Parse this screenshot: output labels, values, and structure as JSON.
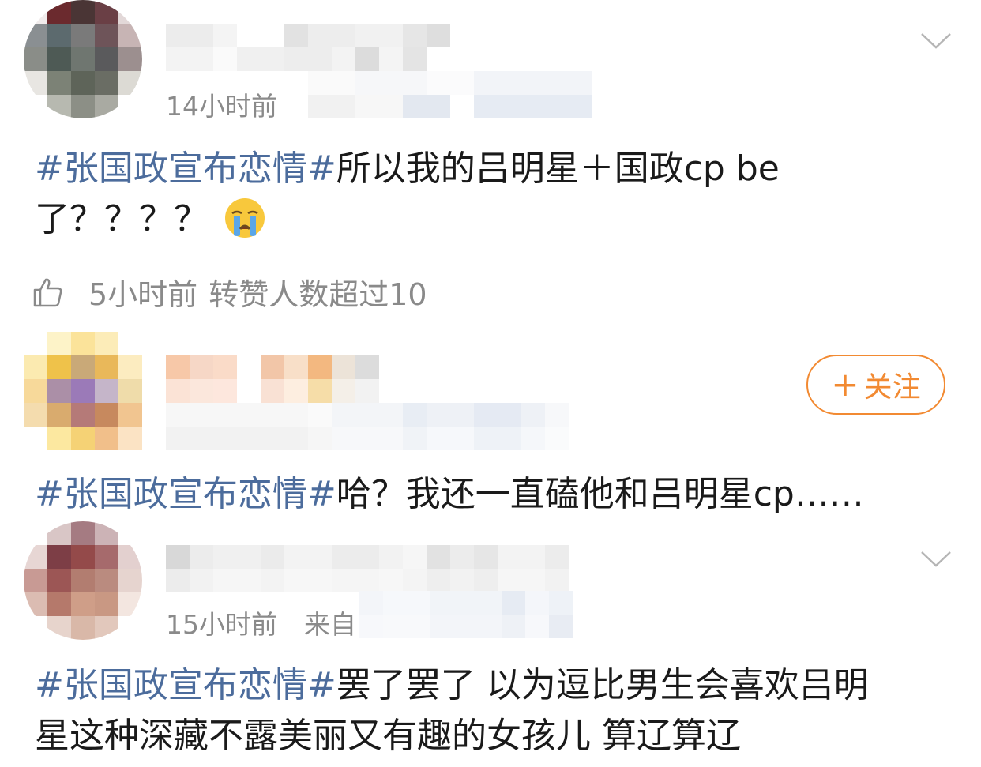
{
  "posts": [
    {
      "time": "14小时前",
      "source_visible": "",
      "text_tag": "#张国政宣布恋情#",
      "text_body": "所以我的吕明星＋国政cp  be",
      "text_body_line2": "了？？？？",
      "emoji_icon": "crying-face-icon",
      "likes_time": "5小时前",
      "likes_text": "转赞人数超过10",
      "has_chevron": true
    },
    {
      "time": "",
      "follow_label": "关注",
      "text_tag": "#张国政宣布恋情#",
      "text_body": "哈？我还一直磕他和吕明星cp……"
    },
    {
      "time": "15小时前",
      "source_prefix": "来自",
      "text_tag": "#张国政宣布恋情#",
      "text_body": "罢了罢了 以为逗比男生会喜欢吕明",
      "text_body_line2": "星这种深藏不露美丽又有趣的女孩儿 算辽算辽",
      "has_chevron": true
    }
  ],
  "colors": {
    "hashtag": "#4c6c9c",
    "meta_gray": "#8a8a8a",
    "follow_orange": "#f28a32",
    "text": "#1a1a1a"
  }
}
